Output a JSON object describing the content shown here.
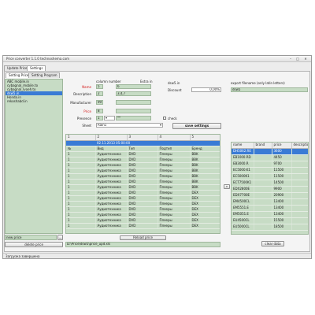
{
  "window": {
    "title": "Price converter 1.1.0 technoshema.com",
    "status": "Загрузка завершена"
  },
  "tabs": [
    "Update Price",
    "Settings"
  ],
  "subtabs": [
    "Setting Price",
    "Setting Program"
  ],
  "price_list": {
    "items": [
      "ABC mobile.in",
      "cybagnal_mobile.to",
      "cybagnal_lvoeh.to",
      "dsw5.in",
      "Honda.in",
      "rekoshabd.in"
    ],
    "selected_index": 3,
    "new_price_value": "new price",
    "delete_label": "delete price"
  },
  "mapping": {
    "col_header_number": "column number",
    "col_header_extra": "Extra in",
    "rows": [
      {
        "label": "Name",
        "required": true,
        "number": "5",
        "extra": "6"
      },
      {
        "label": "Description",
        "required": false,
        "number": "2",
        "extra": "3,4,7"
      },
      {
        "label": "Manufacturer",
        "required": false,
        "number": "99",
        "extra": ""
      },
      {
        "label": "Price",
        "required": true,
        "number": "8",
        "extra": ""
      },
      {
        "label": "Presence",
        "required": false,
        "number": "1",
        "extra": "**"
      }
    ],
    "check_label": "check",
    "sheet_label": "Sheet",
    "sheet_value": "Rain1",
    "save_label": "save settings"
  },
  "discount": {
    "file": "dsw5.in",
    "label": "Discount",
    "value": "0,00%"
  },
  "export": {
    "label": "export filename (only latin letters)",
    "value": "dsw5"
  },
  "grid": {
    "columns": [
      "1",
      "2",
      "3",
      "4",
      "5"
    ],
    "selected_row": "02.11.2013 05:00:00",
    "rows": [
      [
        "№",
        "Вид",
        "Тип",
        "Подтип",
        "Бренд"
      ],
      [
        "1",
        "Аудиотехника",
        "DVD",
        "Плееры",
        "BBK"
      ],
      [
        "1",
        "Аудиотехника",
        "DVD",
        "Плееры",
        "BBK"
      ],
      [
        "1",
        "Аудиотехника",
        "DVD",
        "Плееры",
        "BBK"
      ],
      [
        "1",
        "Аудиотехника",
        "DVD",
        "Плееры",
        "BBK"
      ],
      [
        "1",
        "Аудиотехника",
        "DVD",
        "Плееры",
        "BBK"
      ],
      [
        "1",
        "Аудиотехника",
        "DVD",
        "Плееры",
        "BBK"
      ],
      [
        "1",
        "Аудиотехника",
        "DVD",
        "Плееры",
        "BBK"
      ],
      [
        "1",
        "Аудиотехника",
        "DVD",
        "Плееры",
        "DEX"
      ],
      [
        "1",
        "Аудиотехника",
        "DVD",
        "Плееры",
        "DEX"
      ],
      [
        "1",
        "Аудиотехника",
        "DVD",
        "Плееры",
        "DEX"
      ],
      [
        "1",
        "Аудиотехника",
        "DVD",
        "Плееры",
        "DEX"
      ],
      [
        "1",
        "Аудиотехника",
        "DVD",
        "Плееры",
        "DEX"
      ],
      [
        "1",
        "Аудиотехника",
        "DVD",
        "Плееры",
        "DEX"
      ],
      [
        "1",
        "Аудиотехника",
        "DVD",
        "Плееры",
        "DEX"
      ]
    ],
    "reload_label": "Reload price",
    "path": "D:\\Price\\dsw5\\price_upd.xls"
  },
  "output": {
    "headers": [
      "name",
      "brand",
      "price",
      "descriptio"
    ],
    "rows": [
      [
        "DH5062.RE",
        "",
        "3600"
      ],
      [
        "EB1000.RD",
        "",
        "4450"
      ],
      [
        "EB3000.R",
        "",
        "9700"
      ],
      [
        "EC5000.K1",
        "",
        "11500"
      ],
      [
        "EC5000K1",
        "",
        "11500"
      ],
      [
        "ECT7500K1",
        "",
        "14500"
      ],
      [
        "EDX2800E",
        "",
        "9900"
      ],
      [
        "EDX7700E",
        "",
        "20900"
      ],
      [
        "EM4500CL",
        "",
        "13400"
      ],
      [
        "EM5551.E",
        "",
        "13400"
      ],
      [
        "EM5051.E",
        "",
        "13400"
      ],
      [
        "EU4500CL",
        "",
        "15500"
      ],
      [
        "EU5000CL",
        "",
        "18500"
      ]
    ],
    "clear_label": "clear data"
  }
}
